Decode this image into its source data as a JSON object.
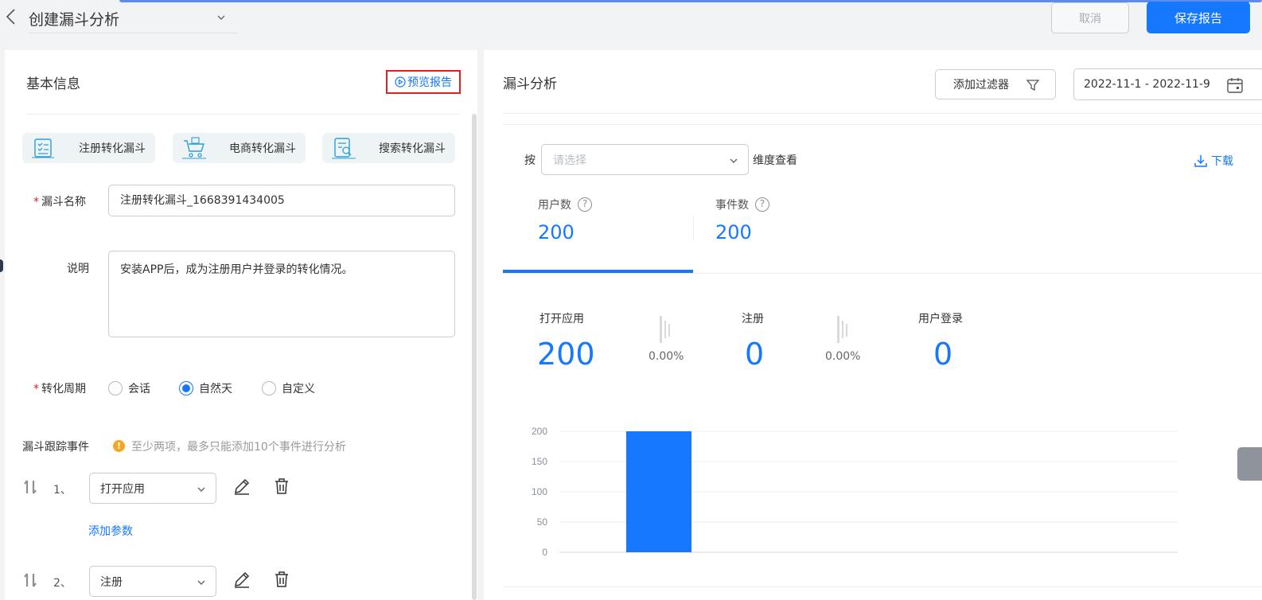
{
  "header": {
    "title": "创建漏斗分析",
    "cancel_label": "取消",
    "save_label": "保存报告"
  },
  "left": {
    "section_title": "基本信息",
    "preview_label": "预览报告",
    "templates": [
      {
        "label": "注册转化漏斗",
        "icon": "checklist-icon"
      },
      {
        "label": "电商转化漏斗",
        "icon": "cart-icon"
      },
      {
        "label": "搜索转化漏斗",
        "icon": "search-doc-icon"
      }
    ],
    "name_label": "漏斗名称",
    "name_value": "注册转化漏斗_1668391434005",
    "desc_label": "说明",
    "desc_value": "安装APP后，成为注册用户并登录的转化情况。",
    "period_label": "转化周期",
    "period_options": [
      {
        "label": "会话",
        "selected": false
      },
      {
        "label": "自然天",
        "selected": true
      },
      {
        "label": "自定义",
        "selected": false
      }
    ],
    "events_title": "漏斗跟踪事件",
    "events_hint_icon": "!",
    "events_hint": "至少两项，最多只能添加10个事件进行分析",
    "events": [
      {
        "num": "1、",
        "value": "打开应用"
      },
      {
        "num": "2、",
        "value": "注册"
      }
    ],
    "add_param_label": "添加参数"
  },
  "right": {
    "title": "漏斗分析",
    "filter_label": "添加过滤器",
    "date_range": "2022-11-1 - 2022-11-9",
    "by_label": "按",
    "dimension_placeholder": "请选择",
    "dimension_suffix": "维度查看",
    "download_label": "下载",
    "stats": [
      {
        "label": "用户数",
        "value": "200",
        "help": "?"
      },
      {
        "label": "事件数",
        "value": "200",
        "help": "?"
      }
    ],
    "steps": [
      {
        "name": "打开应用",
        "value": "200"
      },
      {
        "name": "注册",
        "value": "0"
      },
      {
        "name": "用户登录",
        "value": "0"
      }
    ],
    "conversions": [
      "0.00%",
      "0.00%"
    ],
    "accent_color": "#1677ff"
  },
  "chart_data": {
    "type": "bar",
    "categories": [
      "打开应用",
      "注册",
      "用户登录"
    ],
    "values": [
      200,
      0,
      0
    ],
    "ylim": [
      0,
      200
    ],
    "yticks": [
      "200",
      "150",
      "100",
      "50",
      "0"
    ],
    "grid": true,
    "bar_color": "#1677ff"
  }
}
